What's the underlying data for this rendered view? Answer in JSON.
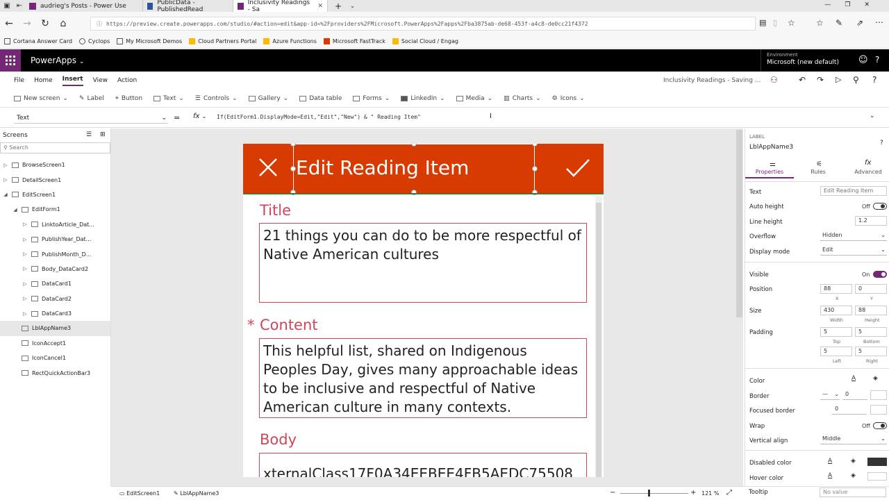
{
  "browser": {
    "tabs": [
      {
        "label": "audrieg's Posts - Power Use",
        "color": "#742774"
      },
      {
        "label": "PublicData - PublishedRead",
        "color": "#2b579a"
      },
      {
        "label": "Inclusivity Readings - Sa",
        "color": "#742774"
      }
    ],
    "url": "https://preview.create.powerapps.com/studio/#action=edit&app-id=%2Fproviders%2FMicrosoft.PowerApps%2Fapps%2Fba3875ab-de68-453f-a4c8-de0cc21f4372",
    "favorites": [
      {
        "label": "Cortana Answer Card",
        "color": "#555555"
      },
      {
        "label": "Cyclops",
        "color": "#555555"
      },
      {
        "label": "My Microsoft Demos",
        "color": "#555555"
      },
      {
        "label": "Cloud Partners Portal",
        "color": "#ffb900"
      },
      {
        "label": "Azure Functions",
        "color": "#ffb900"
      },
      {
        "label": "Microsoft FastTrack",
        "color": "#d83b01"
      },
      {
        "label": "Social Cloud / Engag",
        "color": "#ffb900"
      }
    ]
  },
  "app": {
    "name": "PowerApps",
    "env_label": "Environment",
    "env_value": "Microsoft (new default)",
    "accent": "#742774",
    "saving": "Inclusivity Readings - Saving ..."
  },
  "menus": [
    "File",
    "Home",
    "Insert",
    "View",
    "Action"
  ],
  "toolbar": [
    "New screen",
    "Label",
    "Button",
    "Text",
    "Controls",
    "Gallery",
    "Data table",
    "Forms",
    "LinkedIn",
    "Media",
    "Charts",
    "Icons"
  ],
  "formula": {
    "property": "Text",
    "fx": "fx",
    "code": "If(EditForm1.DisplayMode=Edit,\"Edit\",\"New\") & \" Reading Item\""
  },
  "tree": {
    "header": "Screens",
    "search": "Search",
    "nodes": [
      {
        "label": "BrowseScreen1",
        "indent": 0
      },
      {
        "label": "DetailScreen1",
        "indent": 0
      },
      {
        "label": "EditScreen1",
        "indent": 0
      },
      {
        "label": "EditForm1",
        "indent": 1
      },
      {
        "label": "LinktoArticle_Dat...",
        "indent": 2
      },
      {
        "label": "PublishYear_Dat...",
        "indent": 2
      },
      {
        "label": "PublishMonth_D...",
        "indent": 2
      },
      {
        "label": "Body_DataCard2",
        "indent": 2
      },
      {
        "label": "DataCard1",
        "indent": 2
      },
      {
        "label": "DataCard2",
        "indent": 2
      },
      {
        "label": "DataCard3",
        "indent": 2
      },
      {
        "label": "LblAppName3",
        "indent": 1,
        "selected": true
      },
      {
        "label": "IconAccept1",
        "indent": 1
      },
      {
        "label": "IconCancel1",
        "indent": 1
      },
      {
        "label": "RectQuickActionBar3",
        "indent": 1
      }
    ]
  },
  "form": {
    "header_title": "Edit Reading Item",
    "header_color": "#d83b01",
    "title_label": "Title",
    "title_value": "21 things you can do to be more respectful of Native American cultures",
    "content_required": "*",
    "content_label": "Content",
    "content_value": "This helpful list, shared on Indigenous Peoples Day, gives many approachable ideas to be inclusive and respectful of Native American culture in many contexts.",
    "body_label": "Body",
    "body_value": "xternalClass17F0A34EEBEE4FB5AEDC75508"
  },
  "props": {
    "type": "LABEL",
    "name": "LblAppName3",
    "tabs": [
      "Properties",
      "Rules",
      "Advanced"
    ],
    "text_label": "Text",
    "text_value": "Edit Reading Item",
    "autoheight_label": "Auto height",
    "autoheight_value": "Off",
    "lineheight_label": "Line height",
    "lineheight_value": "1.2",
    "overflow_label": "Overflow",
    "overflow_value": "Hidden",
    "displaymode_label": "Display mode",
    "displaymode_value": "Edit",
    "visible_label": "Visible",
    "visible_value": "On",
    "position_label": "Position",
    "pos_x": "88",
    "pos_y": "0",
    "x": "X",
    "y": "Y",
    "size_label": "Size",
    "width": "430",
    "height": "88",
    "width_lbl": "Width",
    "height_lbl": "Height",
    "padding_label": "Padding",
    "pad_top": "5",
    "pad_bottom": "5",
    "pad_left": "5",
    "pad_right": "5",
    "top_lbl": "Top",
    "bottom_lbl": "Bottom",
    "left_lbl": "Left",
    "right_lbl": "Right",
    "color_label": "Color",
    "color_a": "A",
    "border_label": "Border",
    "border_value": "0",
    "focused_label": "Focused border",
    "focused_value": "0",
    "wrap_label": "Wrap",
    "wrap_value": "Off",
    "valign_label": "Vertical align",
    "valign_value": "Middle",
    "disabled_label": "Disabled color",
    "hover_label": "Hover color",
    "tooltip_label": "Tooltip",
    "tooltip_value": "No value"
  },
  "status": {
    "crumb1": "EditScreen1",
    "crumb2": "LblAppName3",
    "zoom": "121 %"
  }
}
